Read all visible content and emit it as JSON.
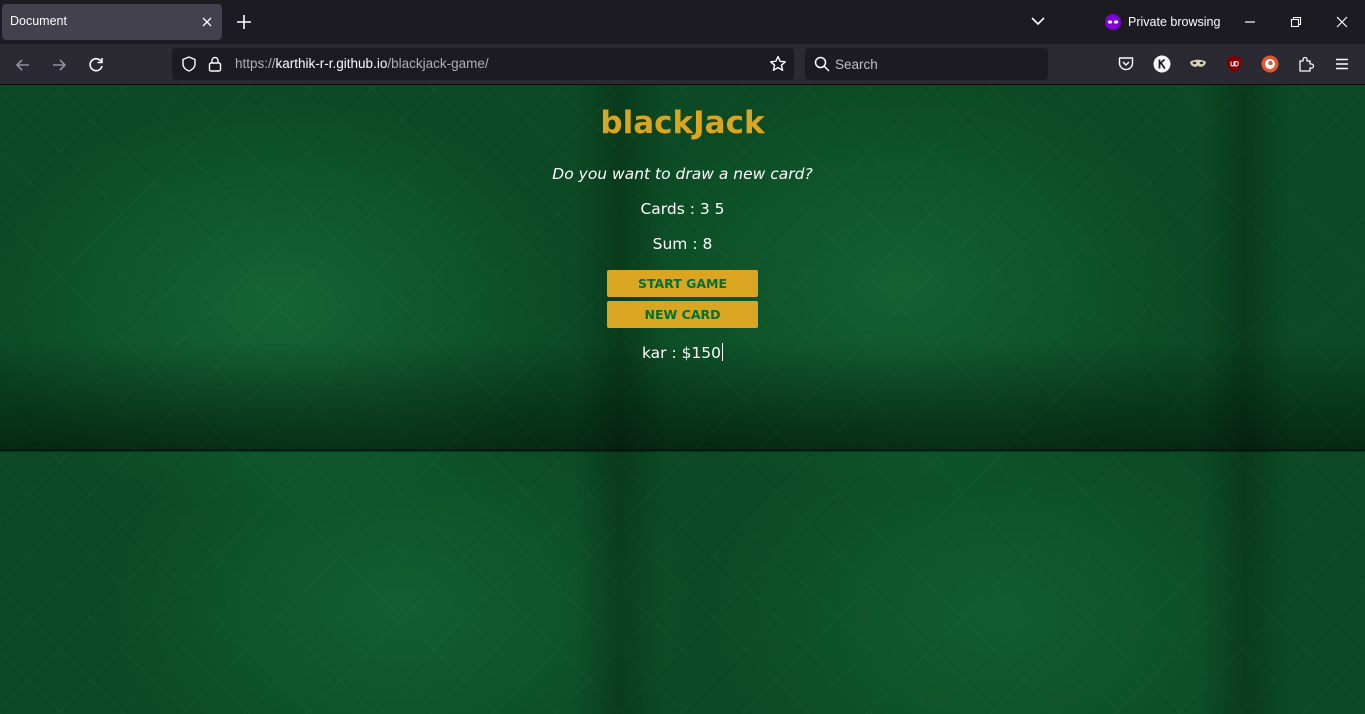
{
  "browser": {
    "tab_title": "Document",
    "private_label": "Private browsing",
    "url_scheme": "https://",
    "url_host": "karthik-r-r.github.io",
    "url_path": "/blackjack-game/",
    "search_placeholder": "Search"
  },
  "game": {
    "title": "blackJack",
    "message": "Do you want to draw a new card?",
    "cards_text": "Cards : 3 5",
    "sum_text": "Sum : 8",
    "start_button": "START GAME",
    "new_card_button": "NEW CARD",
    "player_text": "kar : $150"
  },
  "colors": {
    "accent_gold": "#daa520",
    "felt_green": "#0b4a24",
    "button_text_green": "#016f32"
  },
  "icons": [
    "close-icon",
    "plus-icon",
    "chevron-down-icon",
    "private-mask-icon",
    "minimize-icon",
    "restore-icon",
    "window-close-icon",
    "back-arrow-icon",
    "forward-arrow-icon",
    "reload-icon",
    "shield-icon",
    "lock-icon",
    "star-icon",
    "search-icon",
    "pocket-icon",
    "k-extension-icon",
    "mask-extension-icon",
    "ublock-icon",
    "duckduckgo-icon",
    "extensions-puzzle-icon",
    "menu-icon"
  ]
}
